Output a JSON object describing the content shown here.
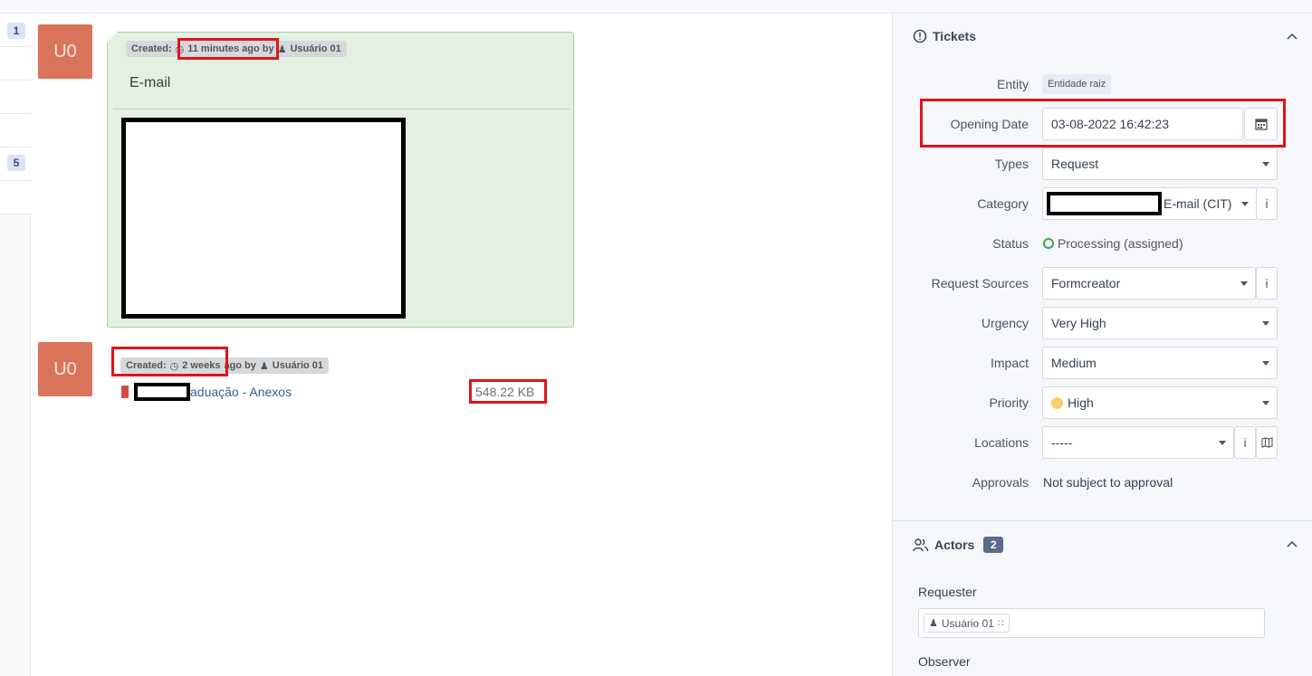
{
  "left_rail": {
    "badges": [
      "1",
      "5"
    ]
  },
  "timeline": {
    "followup": {
      "avatar": "U0",
      "created_label": "Created:",
      "created_ago": "11 minutes ago by",
      "author": "Usuário 01",
      "title": "E-mail"
    },
    "document": {
      "avatar": "U0",
      "created_label": "Created:",
      "created_ago": "2 weeks",
      "created_suffix": "ago by",
      "author": "Usuário 01",
      "name": "aduação - Anexos",
      "size": "548.22 KB"
    }
  },
  "tickets": {
    "section_title": "Tickets",
    "fields": {
      "entity_label": "Entity",
      "entity_value": "Entidade raiz",
      "opening_date_label": "Opening Date",
      "opening_date_value": "03-08-2022 16:42:23",
      "types_label": "Types",
      "types_value": "Request",
      "category_label": "Category",
      "category_value": "E-mail (CIT)",
      "status_label": "Status",
      "status_value": "Processing (assigned)",
      "request_sources_label": "Request Sources",
      "request_sources_value": "Formcreator",
      "urgency_label": "Urgency",
      "urgency_value": "Very High",
      "impact_label": "Impact",
      "impact_value": "Medium",
      "priority_label": "Priority",
      "priority_value": "High",
      "locations_label": "Locations",
      "locations_value": "-----",
      "approvals_label": "Approvals",
      "approvals_value": "Not subject to approval"
    }
  },
  "actors": {
    "section_title": "Actors",
    "count": "2",
    "requester_label": "Requester",
    "requester_name": "Usuário 01",
    "observer_label": "Observer"
  },
  "colors": {
    "avatar": "#d9735a",
    "followup_bg": "#e3f1e1",
    "highlight": "#e2131a",
    "status_green": "#3aa64c",
    "priority_high": "#f7cf6b"
  }
}
